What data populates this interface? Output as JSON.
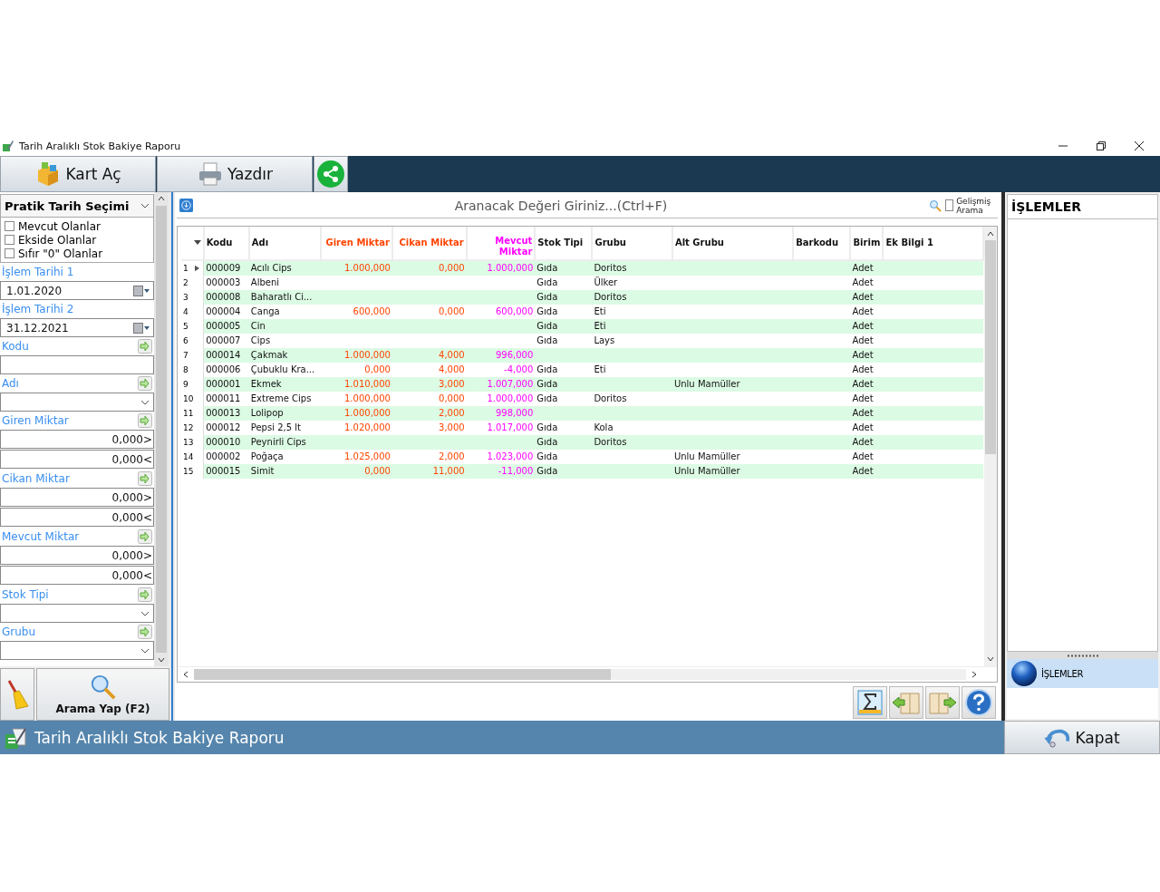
{
  "window": {
    "title": "Tarih Aralıklı Stok Bakiye Raporu"
  },
  "toolbar": [
    {
      "kind": "cube",
      "label": "Kart Aç"
    },
    {
      "kind": "printer",
      "label": "Yazdır"
    },
    {
      "kind": "share"
    }
  ],
  "filter_panel": {
    "preset": "Pratik Tarih Seçimi",
    "checks": [
      {
        "label": "Mevcut Olanlar",
        "checked": false
      },
      {
        "label": "Ekside Olanlar",
        "checked": false
      },
      {
        "label": "Sıfır \"0\" Olanlar",
        "checked": false
      }
    ],
    "fields": [
      {
        "kind": "date",
        "label": "İşlem Tarihi 1",
        "value": "1.01.2020"
      },
      {
        "kind": "date",
        "label": "İşlem Tarihi 2",
        "value": "31.12.2021"
      },
      {
        "kind": "text",
        "label": "Kodu"
      },
      {
        "kind": "combo",
        "label": "Adı"
      },
      {
        "kind": "range",
        "label": "Giren Miktar",
        "values": [
          "0,000>",
          "0,000<"
        ]
      },
      {
        "kind": "range",
        "label": "Cikan Miktar",
        "values": [
          "0,000>",
          "0,000<"
        ]
      },
      {
        "kind": "range",
        "label": "Mevcut Miktar",
        "values": [
          "0,000>",
          "0,000<"
        ]
      },
      {
        "kind": "combo",
        "label": "Stok Tipi"
      },
      {
        "kind": "combo",
        "label": "Grubu"
      }
    ],
    "search_button": "Arama Yap (F2)"
  },
  "search": {
    "placeholder": "Aranacak Değeri Giriniz...(Ctrl+F)",
    "advanced_label": "Gelişmiş Arama",
    "advanced_checked": false
  },
  "table": {
    "columns": [
      {
        "label": "Kodu",
        "kind": "text"
      },
      {
        "label": "Adı",
        "kind": "text"
      },
      {
        "label": "Giren Miktar",
        "kind": "number",
        "color": "#ff4400"
      },
      {
        "label": "Cikan Miktar",
        "kind": "number",
        "color": "#ff4400"
      },
      {
        "label": "Mevcut Miktar",
        "kind": "number",
        "color": "#ff00ff"
      },
      {
        "label": "Stok Tipi",
        "kind": "text"
      },
      {
        "label": "Grubu",
        "kind": "text"
      },
      {
        "label": "Alt Grubu",
        "kind": "text"
      },
      {
        "label": "Barkodu",
        "kind": "text"
      },
      {
        "label": "Birim",
        "kind": "text"
      },
      {
        "label": "Ek Bilgi 1",
        "kind": "text"
      }
    ],
    "rows": [
      {
        "no": "1",
        "selected": true,
        "cells": [
          "000009",
          "Acılı Cips",
          "1.000,000",
          "0,000",
          "1.000,000",
          "Gıda",
          "Doritos",
          "",
          "",
          "Adet",
          ""
        ]
      },
      {
        "no": "2",
        "selected": false,
        "cells": [
          "000003",
          "Albeni",
          "",
          "",
          "",
          "Gıda",
          "Ülker",
          "",
          "",
          "Adet",
          ""
        ]
      },
      {
        "no": "3",
        "selected": false,
        "cells": [
          "000008",
          "Baharatlı Ci...",
          "",
          "",
          "",
          "Gıda",
          "Doritos",
          "",
          "",
          "Adet",
          ""
        ]
      },
      {
        "no": "4",
        "selected": false,
        "cells": [
          "000004",
          "Canga",
          "600,000",
          "0,000",
          "600,000",
          "Gıda",
          "Eti",
          "",
          "",
          "Adet",
          ""
        ]
      },
      {
        "no": "5",
        "selected": false,
        "cells": [
          "000005",
          "Cin",
          "",
          "",
          "",
          "Gıda",
          "Eti",
          "",
          "",
          "Adet",
          ""
        ]
      },
      {
        "no": "6",
        "selected": false,
        "cells": [
          "000007",
          "Cips",
          "",
          "",
          "",
          "Gıda",
          "Lays",
          "",
          "",
          "Adet",
          ""
        ]
      },
      {
        "no": "7",
        "selected": false,
        "cells": [
          "000014",
          "Çakmak",
          "1.000,000",
          "4,000",
          "996,000",
          "",
          "",
          "",
          "",
          "Adet",
          ""
        ]
      },
      {
        "no": "8",
        "selected": false,
        "cells": [
          "000006",
          "Çubuklu Kra...",
          "0,000",
          "4,000",
          "-4,000",
          "Gıda",
          "Eti",
          "",
          "",
          "Adet",
          ""
        ]
      },
      {
        "no": "9",
        "selected": false,
        "cells": [
          "000001",
          "Ekmek",
          "1.010,000",
          "3,000",
          "1.007,000",
          "Gıda",
          "",
          "Unlu Mamüller",
          "",
          "Adet",
          ""
        ]
      },
      {
        "no": "10",
        "selected": false,
        "cells": [
          "000011",
          "Extreme Cips",
          "1.000,000",
          "0,000",
          "1.000,000",
          "Gıda",
          "Doritos",
          "",
          "",
          "Adet",
          ""
        ]
      },
      {
        "no": "11",
        "selected": false,
        "cells": [
          "000013",
          "Lolipop",
          "1.000,000",
          "2,000",
          "998,000",
          "",
          "",
          "",
          "",
          "Adet",
          ""
        ]
      },
      {
        "no": "12",
        "selected": false,
        "cells": [
          "000012",
          "Pepsi 2,5 lt",
          "1.020,000",
          "3,000",
          "1.017,000",
          "Gıda",
          "Kola",
          "",
          "",
          "Adet",
          ""
        ]
      },
      {
        "no": "13",
        "selected": false,
        "cells": [
          "000010",
          "Peynirli Cips",
          "",
          "",
          "",
          "Gıda",
          "Doritos",
          "",
          "",
          "Adet",
          ""
        ]
      },
      {
        "no": "14",
        "selected": false,
        "cells": [
          "000002",
          "Poğaça",
          "1.025,000",
          "2,000",
          "1.023,000",
          "Gıda",
          "",
          "Unlu Mamüller",
          "",
          "Adet",
          ""
        ]
      },
      {
        "no": "15",
        "selected": false,
        "cells": [
          "000015",
          "Simit",
          "0,000",
          "11,000",
          "-11,000",
          "Gıda",
          "",
          "Unlu Mamüller",
          "",
          "Adet",
          ""
        ]
      }
    ]
  },
  "grid_buttons": [
    {
      "kind": "sum"
    },
    {
      "kind": "prev"
    },
    {
      "kind": "next"
    },
    {
      "kind": "help"
    }
  ],
  "side_panel": {
    "title": "İŞLEMLER",
    "items": [
      {
        "label": "İŞLEMLER",
        "selected": true
      }
    ]
  },
  "status_bar": {
    "title": "Tarih Aralıklı Stok Bakiye Raporu",
    "close_button": "Kapat"
  }
}
